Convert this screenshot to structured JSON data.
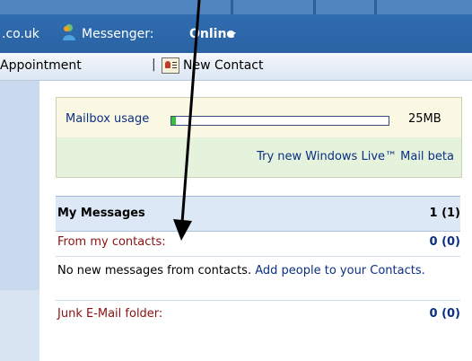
{
  "header": {
    "domain_fragment": ".co.uk",
    "messenger_label": "Messenger:",
    "messenger_status": "Online",
    "messenger_icon": "messenger-person-icon",
    "status_caret_icon": "chevron-down-icon"
  },
  "toolbar": {
    "appointment_label": "Appointment",
    "separator": "|",
    "new_contact_label": "New Contact",
    "new_contact_icon": "contact-card-icon"
  },
  "mailbox": {
    "usage_label": "Mailbox usage",
    "usage_fraction": 0.01,
    "usage_size": "25MB",
    "beta_link": "Try new Windows Live™ Mail beta",
    "fill_color": "#36c13a"
  },
  "messages": {
    "title": "My Messages",
    "total": "1 (1)",
    "contacts_label": "From my contacts:",
    "contacts_count": "0 (0)",
    "info_text": "No new messages from contacts.",
    "info_link": "Add people to your Contacts.",
    "junk_label": "Junk E-Mail folder:",
    "junk_count": "0 (0)"
  },
  "colors": {
    "header_blue": "#2f6cb0",
    "link_blue": "#0b2f83",
    "label_red": "#8c1010"
  }
}
